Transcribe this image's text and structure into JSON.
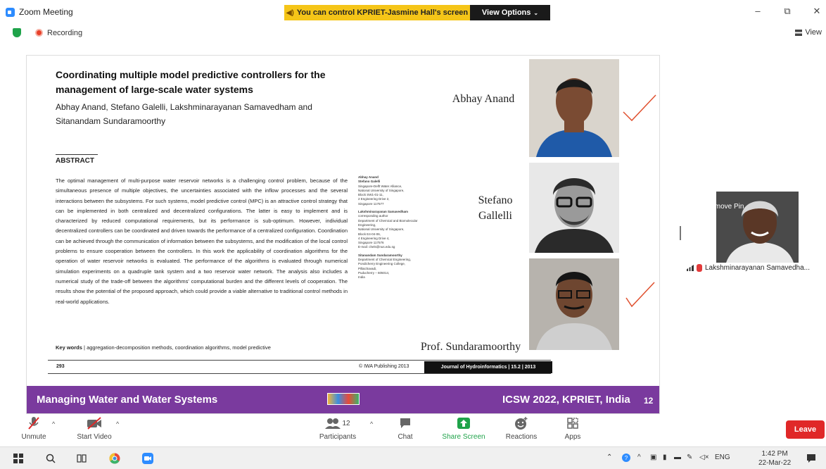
{
  "window": {
    "title": "Zoom Meeting",
    "control_banner": "You can control KPRIET-Jasmine Hall's screen",
    "view_options": "View Options",
    "minimize_glyph": "–",
    "restore_glyph": "⧉",
    "close_glyph": "✕"
  },
  "status": {
    "recording": "Recording",
    "view_label": "View"
  },
  "slide": {
    "paper_title": "Coordinating multiple model predictive controllers for the management of large-scale water systems",
    "paper_authors": "Abhay Anand, Stefano Galelli, Lakshminarayanan Samavedham and Sitanandam Sundaramoorthy",
    "abstract_heading": "ABSTRACT",
    "abstract_text": "The optimal management of multi-purpose water reservoir networks is a challenging control problem, because of the simultaneous presence of multiple objectives, the uncertainties associated with the inflow processes and the several interactions between the subsystems. For such systems, model predictive control (MPC) is an attractive control strategy that can be implemented in both centralized and decentralized configurations. The latter is easy to implement and is characterized by reduced computational requirements, but its performance is sub-optimum. However, individual decentralized controllers can be coordinated and driven towards the performance of a centralized configuration. Coordination can be achieved through the communication of information between the subsystems, and the modification of the local control problems to ensure cooperation between the controllers. In this work the applicability of coordination algorithms for the operation of water reservoir networks is evaluated. The performance of the algorithms is evaluated through numerical simulation experiments on a quadruple tank system and a two reservoir water network. The analysis also includes a numerical study of the trade-off between the algorithms' computational burden and the different levels of cooperation. The results show the potential of the proposed approach, which could provide a viable alternative to traditional control methods in real-world applications.",
    "keywords_label": "Key words",
    "keywords_text": "aggregation-decomposition methods, coordination algorithms, model predictive",
    "affiliations": [
      {
        "names": "Abhay Anand\nStefano Galelli",
        "lines": "Singapore-Delft Water Alliance,\nNational University of Singapore,\nBlock SW1-01-11,\n2 Engineering Drive 2,\nSingapore 117577"
      },
      {
        "names": "Lakshminarayanan Samavedham",
        "lines": "corresponding author\nDepartment of Chemical and Biomolecular\nEngineering,\nNational University of Singapore,\nBlock E4-04-06,\n4 Engineering Drive 4,\nSingapore 117576\nE-mail: chels@nus.edu.sg"
      },
      {
        "names": "Sitanandam Sundaramoorthy",
        "lines": "Department of Chemical Engineering,\nPondicherry Engineering College,\nPillaichavadi,\nPuducherry – 605014,\nIndia"
      }
    ],
    "page_number": "293",
    "publisher": "© IWA Publishing 2013",
    "journal": "Journal of Hydroinformatics | 15.2 | 2013",
    "speaker_1": "Abhay Anand",
    "speaker_2": "Stefano\nGallelli",
    "speaker_3": "Prof. Sundaramoorthy",
    "band_left": "Managing Water and Water Systems",
    "band_right": "ICSW 2022, KPRIET, India",
    "slide_number": "12"
  },
  "participant": {
    "remove_pin": "Remove Pin",
    "name": "Lakshminarayanan Samavedha..."
  },
  "toolbar": {
    "unmute": "Unmute",
    "start_video": "Start Video",
    "participants": "Participants",
    "participants_count": "12",
    "chat": "Chat",
    "share_screen": "Share Screen",
    "reactions": "Reactions",
    "apps": "Apps",
    "leave": "Leave"
  },
  "taskbar": {
    "language": "ENG",
    "time": "1:42 PM",
    "date": "22-Mar-22"
  },
  "colors": {
    "accent_green": "#1fa34a",
    "leave_red": "#e02828",
    "banner_yellow": "#f5c518",
    "slide_purple": "#7a3a9e"
  }
}
